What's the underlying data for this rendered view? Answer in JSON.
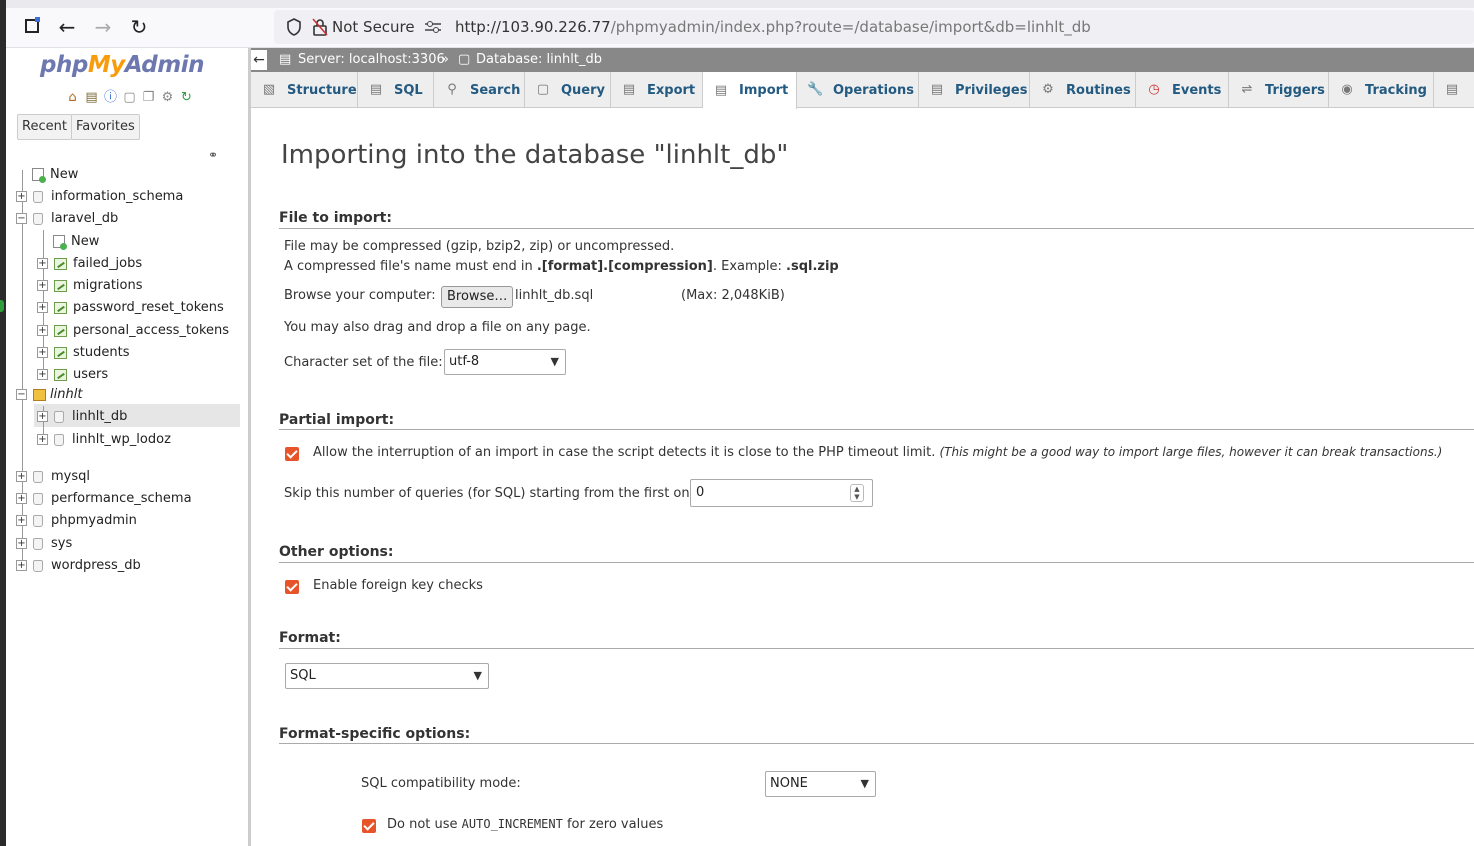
{
  "browser": {
    "not_secure": "Not Secure",
    "url_host": "http://103.90.226.77",
    "url_path": "/phpmyadmin/index.php?route=/database/import&db=linhlt_db"
  },
  "sidebar": {
    "logo_php": "php",
    "logo_my": "My",
    "logo_admin": "Admin",
    "recent": "Recent",
    "favorites": "Favorites",
    "tree": {
      "new_top": "New",
      "information_schema": "information_schema",
      "laravel_db": "laravel_db",
      "laravel_new": "New",
      "failed_jobs": "failed_jobs",
      "migrations": "migrations",
      "password_reset_tokens": "password_reset_tokens",
      "personal_access_tokens": "personal_access_tokens",
      "students": "students",
      "users": "users",
      "linhlt": "linhlt",
      "linhlt_db": "linhlt_db",
      "linhlt_wp_lodoz": "linhlt_wp_lodoz",
      "mysql": "mysql",
      "performance_schema": "performance_schema",
      "phpmyadmin": "phpmyadmin",
      "sys": "sys",
      "wordpress_db": "wordpress_db"
    }
  },
  "breadcrumb": {
    "server": "Server: localhost:3306",
    "sep": "»",
    "database": "Database: linhlt_db"
  },
  "tabs": [
    {
      "label": "Structure"
    },
    {
      "label": "SQL"
    },
    {
      "label": "Search"
    },
    {
      "label": "Query"
    },
    {
      "label": "Export"
    },
    {
      "label": "Import"
    },
    {
      "label": "Operations"
    },
    {
      "label": "Privileges"
    },
    {
      "label": "Routines"
    },
    {
      "label": "Events"
    },
    {
      "label": "Triggers"
    },
    {
      "label": "Tracking"
    }
  ],
  "main": {
    "title": "Importing into the database \"linhlt_db\"",
    "file_section": {
      "heading": "File to import:",
      "line1": "File may be compressed (gzip, bzip2, zip) or uncompressed.",
      "line2_pre": "A compressed file's name must end in ",
      "line2_bold": ".[format].[compression]",
      "line2_mid": ". Example: ",
      "line2_example": ".sql.zip",
      "browse_label": "Browse your computer:",
      "browse_button": "Browse…",
      "file_name": "linhlt_db.sql",
      "max_size": "(Max: 2,048KiB)",
      "drag_drop": "You may also drag and drop a file on any page.",
      "charset_label": "Character set of the file:",
      "charset_value": "utf-8"
    },
    "partial_section": {
      "heading": "Partial import:",
      "allow_interrupt": "Allow the interruption of an import in case the script detects it is close to the PHP timeout limit.",
      "allow_interrupt_note": "(This might be a good way to import large files, however it can break transactions.)",
      "skip_label": "Skip this number of queries (for SQL) starting from the first one:",
      "skip_value": "0"
    },
    "other_section": {
      "heading": "Other options:",
      "fk_checks": "Enable foreign key checks"
    },
    "format_section": {
      "heading": "Format:",
      "format_value": "SQL"
    },
    "format_specific": {
      "heading": "Format-specific options:",
      "compat_label": "SQL compatibility mode:",
      "compat_value": "NONE",
      "auto_inc_pre": "Do not use ",
      "auto_inc_code": "AUTO_INCREMENT",
      "auto_inc_post": " for zero values"
    }
  }
}
